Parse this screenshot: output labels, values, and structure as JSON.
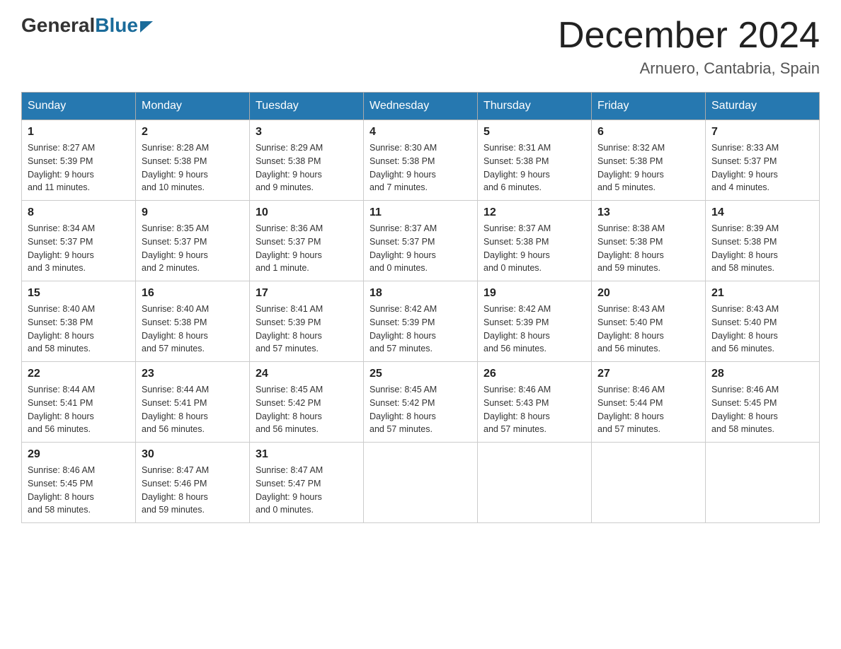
{
  "header": {
    "logo": {
      "general": "General",
      "blue": "Blue",
      "arrow": true
    },
    "title": "December 2024",
    "location": "Arnuero, Cantabria, Spain"
  },
  "calendar": {
    "days_of_week": [
      "Sunday",
      "Monday",
      "Tuesday",
      "Wednesday",
      "Thursday",
      "Friday",
      "Saturday"
    ],
    "weeks": [
      [
        {
          "day": "1",
          "sunrise": "8:27 AM",
          "sunset": "5:39 PM",
          "daylight": "9 hours and 11 minutes."
        },
        {
          "day": "2",
          "sunrise": "8:28 AM",
          "sunset": "5:38 PM",
          "daylight": "9 hours and 10 minutes."
        },
        {
          "day": "3",
          "sunrise": "8:29 AM",
          "sunset": "5:38 PM",
          "daylight": "9 hours and 9 minutes."
        },
        {
          "day": "4",
          "sunrise": "8:30 AM",
          "sunset": "5:38 PM",
          "daylight": "9 hours and 7 minutes."
        },
        {
          "day": "5",
          "sunrise": "8:31 AM",
          "sunset": "5:38 PM",
          "daylight": "9 hours and 6 minutes."
        },
        {
          "day": "6",
          "sunrise": "8:32 AM",
          "sunset": "5:38 PM",
          "daylight": "9 hours and 5 minutes."
        },
        {
          "day": "7",
          "sunrise": "8:33 AM",
          "sunset": "5:37 PM",
          "daylight": "9 hours and 4 minutes."
        }
      ],
      [
        {
          "day": "8",
          "sunrise": "8:34 AM",
          "sunset": "5:37 PM",
          "daylight": "9 hours and 3 minutes."
        },
        {
          "day": "9",
          "sunrise": "8:35 AM",
          "sunset": "5:37 PM",
          "daylight": "9 hours and 2 minutes."
        },
        {
          "day": "10",
          "sunrise": "8:36 AM",
          "sunset": "5:37 PM",
          "daylight": "9 hours and 1 minute."
        },
        {
          "day": "11",
          "sunrise": "8:37 AM",
          "sunset": "5:37 PM",
          "daylight": "9 hours and 0 minutes."
        },
        {
          "day": "12",
          "sunrise": "8:37 AM",
          "sunset": "5:38 PM",
          "daylight": "9 hours and 0 minutes."
        },
        {
          "day": "13",
          "sunrise": "8:38 AM",
          "sunset": "5:38 PM",
          "daylight": "8 hours and 59 minutes."
        },
        {
          "day": "14",
          "sunrise": "8:39 AM",
          "sunset": "5:38 PM",
          "daylight": "8 hours and 58 minutes."
        }
      ],
      [
        {
          "day": "15",
          "sunrise": "8:40 AM",
          "sunset": "5:38 PM",
          "daylight": "8 hours and 58 minutes."
        },
        {
          "day": "16",
          "sunrise": "8:40 AM",
          "sunset": "5:38 PM",
          "daylight": "8 hours and 57 minutes."
        },
        {
          "day": "17",
          "sunrise": "8:41 AM",
          "sunset": "5:39 PM",
          "daylight": "8 hours and 57 minutes."
        },
        {
          "day": "18",
          "sunrise": "8:42 AM",
          "sunset": "5:39 PM",
          "daylight": "8 hours and 57 minutes."
        },
        {
          "day": "19",
          "sunrise": "8:42 AM",
          "sunset": "5:39 PM",
          "daylight": "8 hours and 56 minutes."
        },
        {
          "day": "20",
          "sunrise": "8:43 AM",
          "sunset": "5:40 PM",
          "daylight": "8 hours and 56 minutes."
        },
        {
          "day": "21",
          "sunrise": "8:43 AM",
          "sunset": "5:40 PM",
          "daylight": "8 hours and 56 minutes."
        }
      ],
      [
        {
          "day": "22",
          "sunrise": "8:44 AM",
          "sunset": "5:41 PM",
          "daylight": "8 hours and 56 minutes."
        },
        {
          "day": "23",
          "sunrise": "8:44 AM",
          "sunset": "5:41 PM",
          "daylight": "8 hours and 56 minutes."
        },
        {
          "day": "24",
          "sunrise": "8:45 AM",
          "sunset": "5:42 PM",
          "daylight": "8 hours and 56 minutes."
        },
        {
          "day": "25",
          "sunrise": "8:45 AM",
          "sunset": "5:42 PM",
          "daylight": "8 hours and 57 minutes."
        },
        {
          "day": "26",
          "sunrise": "8:46 AM",
          "sunset": "5:43 PM",
          "daylight": "8 hours and 57 minutes."
        },
        {
          "day": "27",
          "sunrise": "8:46 AM",
          "sunset": "5:44 PM",
          "daylight": "8 hours and 57 minutes."
        },
        {
          "day": "28",
          "sunrise": "8:46 AM",
          "sunset": "5:45 PM",
          "daylight": "8 hours and 58 minutes."
        }
      ],
      [
        {
          "day": "29",
          "sunrise": "8:46 AM",
          "sunset": "5:45 PM",
          "daylight": "8 hours and 58 minutes."
        },
        {
          "day": "30",
          "sunrise": "8:47 AM",
          "sunset": "5:46 PM",
          "daylight": "8 hours and 59 minutes."
        },
        {
          "day": "31",
          "sunrise": "8:47 AM",
          "sunset": "5:47 PM",
          "daylight": "9 hours and 0 minutes."
        },
        null,
        null,
        null,
        null
      ]
    ],
    "labels": {
      "sunrise": "Sunrise:",
      "sunset": "Sunset:",
      "daylight": "Daylight:"
    }
  }
}
